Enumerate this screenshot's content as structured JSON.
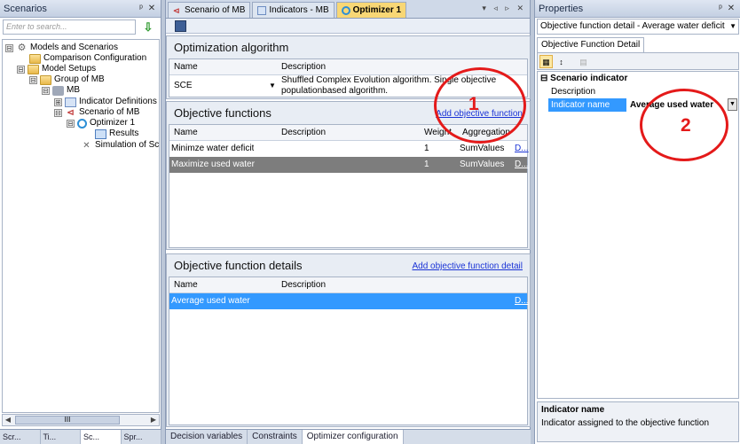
{
  "left_panel": {
    "title": "Scenarios",
    "search_placeholder": "Enter to search...",
    "tree": [
      {
        "label": "Models and Scenarios",
        "toggle": "⊟"
      },
      {
        "label": "Comparison Configuration",
        "toggle": ""
      },
      {
        "label": "Model Setups",
        "toggle": "⊟"
      },
      {
        "label": "Group of MB",
        "toggle": "⊟"
      },
      {
        "label": "MB",
        "toggle": "⊟"
      },
      {
        "label": "Indicator Definitions",
        "toggle": "⊞"
      },
      {
        "label": "Scenario of MB",
        "toggle": "⊟"
      },
      {
        "label": "Optimizer 1",
        "toggle": "⊟"
      },
      {
        "label": "Results",
        "toggle": ""
      },
      {
        "label": "Simulation of Scer",
        "toggle": ""
      }
    ],
    "scroll_thumb": "III",
    "bottom_tabs": [
      "Scr...",
      "Ti...",
      "Sc...",
      "Spr..."
    ]
  },
  "center": {
    "doc_tabs": [
      "Scenario of MB",
      "Indicators - MB",
      "Optimizer 1"
    ],
    "doc_tab_controls": "▾ ◃ ▹ ✕",
    "optimization": {
      "title": "Optimization algorithm",
      "headers": [
        "Name",
        "Description"
      ],
      "row": {
        "name": "SCE",
        "description_line1": "Shuffled Complex Evolution algorithm. Single objective",
        "description_line2": "populationbased algorithm."
      }
    },
    "objectives": {
      "title": "Objective functions",
      "link": "Add objective function",
      "headers": [
        "Name",
        "Description",
        "Weight",
        "Aggregation"
      ],
      "rows": [
        {
          "name": "Minimze water deficit",
          "weight": "1",
          "aggregation": "SumValues",
          "action": "D..."
        },
        {
          "name": "Maximize used water",
          "weight": "1",
          "aggregation": "SumValues",
          "action": "D..."
        }
      ]
    },
    "details": {
      "title": "Objective function details",
      "link": "Add objective function detail",
      "headers": [
        "Name",
        "Description"
      ],
      "rows": [
        {
          "name": "Average used water",
          "action": "D..."
        }
      ]
    },
    "bottom_tabs": [
      "Decision variables",
      "Constraints",
      "Optimizer configuration"
    ]
  },
  "right_panel": {
    "title": "Properties",
    "object_selector": "Objective function detail - Average water deficit",
    "tab": "Objective Function Detail",
    "category": "Scenario indicator",
    "props": [
      {
        "name": "Description",
        "value": ""
      },
      {
        "name": "Indicator name",
        "value": "Average used water"
      }
    ],
    "desc_title": "Indicator name",
    "desc_text": "Indicator assigned to the objective function"
  },
  "annotations": [
    "1",
    "2"
  ],
  "colors": {
    "accent_tab": "#f8d775",
    "selection_blue": "#3399ff",
    "annotation_red": "#e41a1a"
  }
}
